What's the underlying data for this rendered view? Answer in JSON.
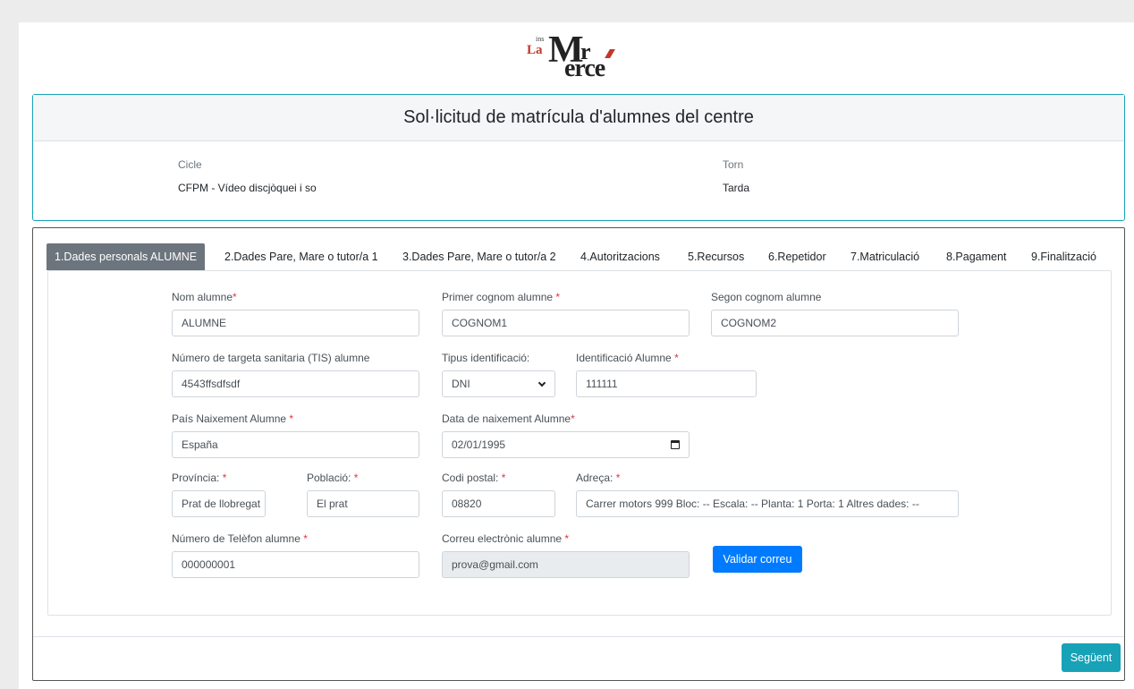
{
  "logo": {
    "ins": "ins",
    "la": "La",
    "m": "M",
    "r": "r",
    "erce": "erce"
  },
  "header": {
    "title": "Sol·licitud de matrícula d'alumnes del centre",
    "cicle_label": "Cicle",
    "cicle_value": "CFPM - Vídeo discjòquei i so",
    "torn_label": "Torn",
    "torn_value": "Tarda"
  },
  "tabs": [
    "1.Dades personals ALUMNE",
    "2.Dades Pare, Mare o tutor/a 1",
    "3.Dades Pare, Mare o tutor/a 2",
    "4.Autoritzacions",
    "5.Recursos",
    "6.Repetidor",
    "7.Matriculació",
    "8.Pagament",
    "9.Finalització"
  ],
  "form": {
    "nom_label": "Nom alumne",
    "nom_value": "ALUMNE",
    "cognom1_label": "Primer cognom alumne ",
    "cognom1_value": "COGNOM1",
    "cognom2_label": "Segon cognom alumne",
    "cognom2_value": "COGNOM2",
    "tis_label": "Número de targeta sanitaria (TIS) alumne",
    "tis_value": "4543ffsdfsdf",
    "tipus_label": "Tipus identificació:",
    "tipus_value": "DNI",
    "ident_label": "Identificació Alumne ",
    "ident_value": "111111",
    "pais_label": "País Naixement Alumne ",
    "pais_value": "España",
    "data_label": "Data de naixement Alumne",
    "data_value": "02/01/1995",
    "provincia_label": "Província: ",
    "provincia_value": "Prat de llobregat",
    "poblacio_label": "Població: ",
    "poblacio_value": "El prat",
    "codi_label": "Codi postal: ",
    "codi_value": "08820",
    "adreca_label": "Adreça: ",
    "adreca_value": "Carrer motors 999 Bloc: -- Escala: -- Planta: 1 Porta: 1 Altres dades: --",
    "telefon_label": "Número de Telèfon alumne ",
    "telefon_value": "000000001",
    "correu_label": "Correu electrònic alumne ",
    "correu_value": "prova@gmail.com",
    "validar_button": "Validar correu",
    "required_mark": "*"
  },
  "footer": {
    "next_button": "Següent"
  },
  "colors": {
    "primary": "#007bff",
    "info": "#17a2b8",
    "active_tab": "#6c757d",
    "required": "#dc3545"
  }
}
